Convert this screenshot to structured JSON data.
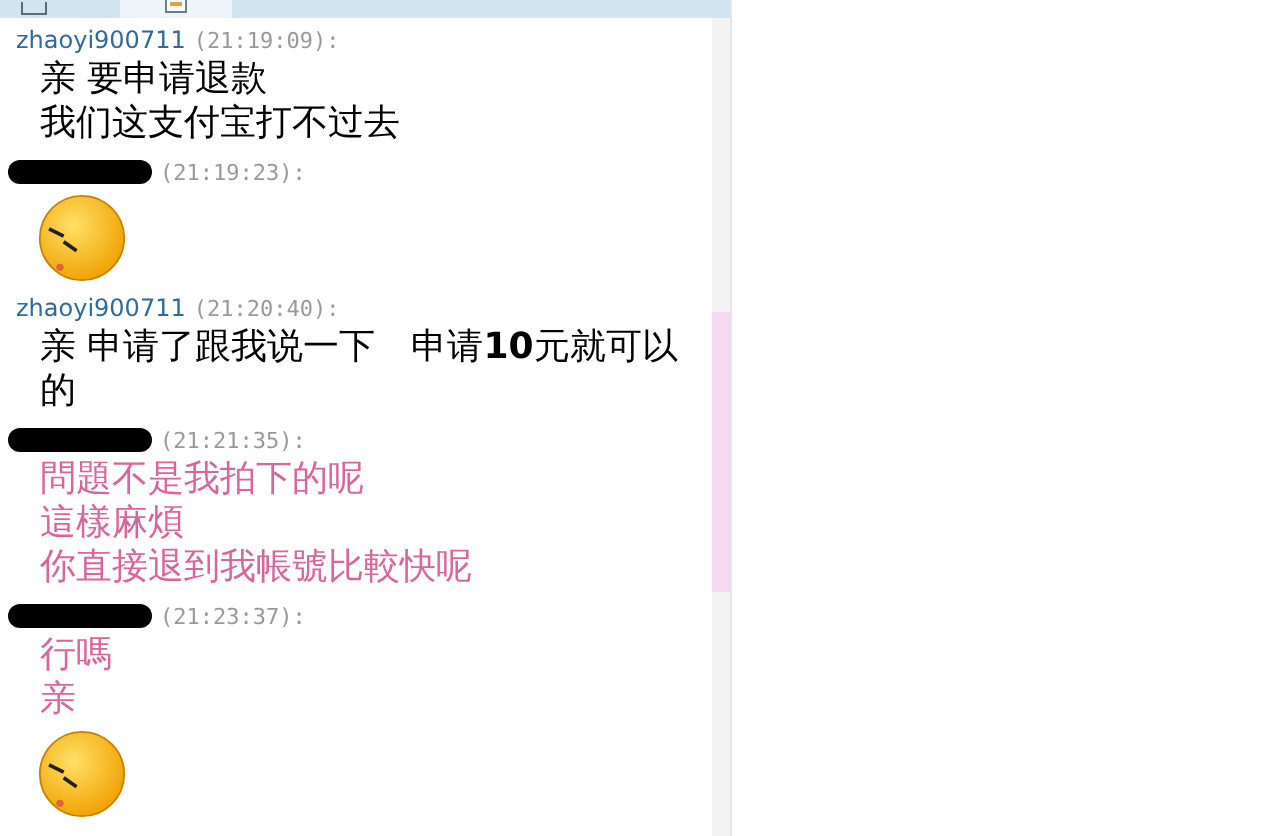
{
  "messages": [
    {
      "sender": "zhaoyi900711",
      "time": "(21:19:09):",
      "kind": "text",
      "color": "#000000",
      "lines": [
        "亲 要申请退款",
        "我们这支付宝打不过去"
      ]
    },
    {
      "time": "(21:19:23):",
      "kind": "emoticon"
    },
    {
      "sender": "zhaoyi900711",
      "time": "(21:20:40):",
      "kind": "text",
      "color": "#000000",
      "lines": [
        "亲 申请了跟我说一下　申请**10**元就可以的"
      ]
    },
    {
      "time": "(21:21:35):",
      "kind": "text",
      "color": "#d9659f",
      "lines": [
        "問題不是我拍下的呢",
        "這樣麻煩",
        "你直接退到我帳號比較快呢"
      ]
    },
    {
      "time": "(21:23:37):",
      "kind": "text",
      "color": "#d9659f",
      "lines": [
        "行嗎",
        "亲"
      ]
    },
    {
      "kind": "emoticon"
    }
  ]
}
